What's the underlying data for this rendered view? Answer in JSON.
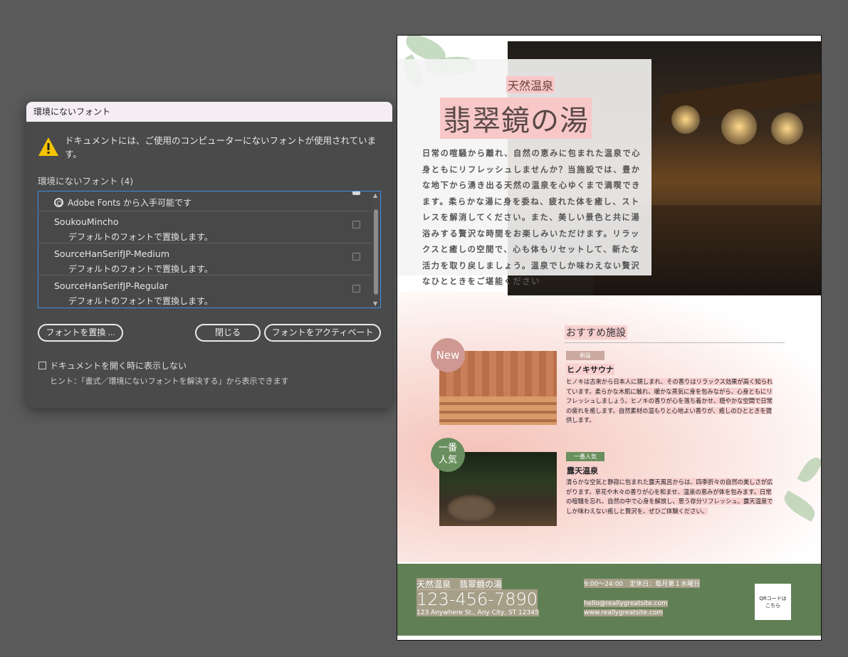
{
  "dialog": {
    "title": "環境にないフォント",
    "warning": "ドキュメントには、ご使用のコンピューターにないフォントが使用されています。",
    "missing_label": "環境にないフォント (4)",
    "fonts": [
      {
        "name": "",
        "status": "Adobe Fonts から入手可能です",
        "checked": true
      },
      {
        "name": "SoukouMincho",
        "status": "デフォルトのフォントで置換します。",
        "checked": false
      },
      {
        "name": "SourceHanSerifJP-Medium",
        "status": "デフォルトのフォントで置換します。",
        "checked": false
      },
      {
        "name": "SourceHanSerifJP-Regular",
        "status": "デフォルトのフォントで置換します。",
        "checked": false
      }
    ],
    "buttons": {
      "replace": "フォントを置換 ...",
      "close": "閉じる",
      "activate": "フォントをアクティベート"
    },
    "dont_show": "ドキュメントを開く時に表示しない",
    "hint": "ヒント：「書式／環境にないフォントを解決する」から表示できます"
  },
  "document": {
    "spa_label": "天然温泉",
    "spa_title": "翡翠鏡の湯",
    "intro": "日常の喧騒から離れ、自然の恵みに包まれた温泉で心身ともにリフレッシュしませんか？当施設では、豊かな地下から湧き出る天然の温泉を心ゆくまで満喫できます。柔らかな湯に身を委ね、疲れた体を癒し、ストレスを解消してください。また、美しい景色と共に湯浴みする贅沢な時間をお楽しみいただけます。リラックスと癒しの空間で、心も体もリセットして、新たな活力を取り戻しましょう。温泉でしか味わえない贅沢なひとときをご堪能ください",
    "section_title": "おすすめ施設",
    "facilities": [
      {
        "badge": "New",
        "tag": "新設",
        "name": "ヒノキサウナ",
        "desc": "ヒノキは古来から日本人に親しまれ、その香りはリラックス効果が高く知られています。柔らかな木肌に触れ、暖かな蒸気に身を包みながら、心身ともにリフレッシュしましょう。ヒノキの香りが心を落ち着かせ、穏やかな空間で日常の疲れを癒します。自然素材の温もりと心地よい香りが、癒しのひとときを提供します。"
      },
      {
        "badge_line1": "一番",
        "badge_line2": "人気",
        "tag": "一番人気",
        "name": "露天温泉",
        "desc": "清らかな空気と静寂に包まれた露天風呂からは、四季折々の自然の美しさが広がります。草花や木々の香りが心を和ませ、温泉の恵みが体を包みます。日常の喧騒を忘れ、自然の中で心身を解放し、思う存分リフレッシュ。露天温泉でしか味わえない癒しと贅沢を、ぜひご体験ください。"
      }
    ],
    "footer": {
      "name": "天然温泉　翡翠鏡の湯",
      "phone": "123-456-7890",
      "address": "123 Anywhere St., Any City, ST 12345",
      "hours": "9:00～24:00　定休日：毎月第１水曜日",
      "email": "hello@reallygreatsite.com",
      "web": "www.reallygreatsite.com",
      "qr": "QRコードは\nこちら"
    }
  }
}
